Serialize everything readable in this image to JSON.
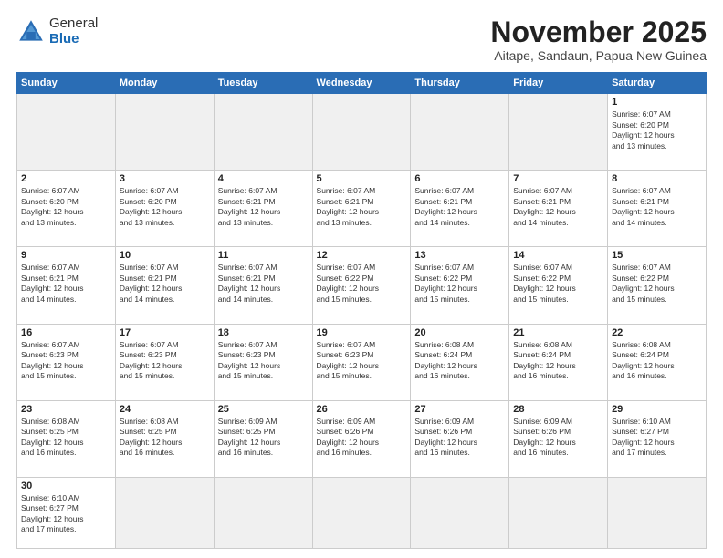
{
  "header": {
    "logo_general": "General",
    "logo_blue": "Blue",
    "month": "November 2025",
    "location": "Aitape, Sandaun, Papua New Guinea"
  },
  "days_of_week": [
    "Sunday",
    "Monday",
    "Tuesday",
    "Wednesday",
    "Thursday",
    "Friday",
    "Saturday"
  ],
  "weeks": [
    [
      {
        "day": "",
        "info": "",
        "empty": true
      },
      {
        "day": "",
        "info": "",
        "empty": true
      },
      {
        "day": "",
        "info": "",
        "empty": true
      },
      {
        "day": "",
        "info": "",
        "empty": true
      },
      {
        "day": "",
        "info": "",
        "empty": true
      },
      {
        "day": "",
        "info": "",
        "empty": true
      },
      {
        "day": "1",
        "info": "Sunrise: 6:07 AM\nSunset: 6:20 PM\nDaylight: 12 hours\nand 13 minutes."
      }
    ],
    [
      {
        "day": "2",
        "info": "Sunrise: 6:07 AM\nSunset: 6:20 PM\nDaylight: 12 hours\nand 13 minutes."
      },
      {
        "day": "3",
        "info": "Sunrise: 6:07 AM\nSunset: 6:20 PM\nDaylight: 12 hours\nand 13 minutes."
      },
      {
        "day": "4",
        "info": "Sunrise: 6:07 AM\nSunset: 6:21 PM\nDaylight: 12 hours\nand 13 minutes."
      },
      {
        "day": "5",
        "info": "Sunrise: 6:07 AM\nSunset: 6:21 PM\nDaylight: 12 hours\nand 13 minutes."
      },
      {
        "day": "6",
        "info": "Sunrise: 6:07 AM\nSunset: 6:21 PM\nDaylight: 12 hours\nand 14 minutes."
      },
      {
        "day": "7",
        "info": "Sunrise: 6:07 AM\nSunset: 6:21 PM\nDaylight: 12 hours\nand 14 minutes."
      },
      {
        "day": "8",
        "info": "Sunrise: 6:07 AM\nSunset: 6:21 PM\nDaylight: 12 hours\nand 14 minutes."
      }
    ],
    [
      {
        "day": "9",
        "info": "Sunrise: 6:07 AM\nSunset: 6:21 PM\nDaylight: 12 hours\nand 14 minutes."
      },
      {
        "day": "10",
        "info": "Sunrise: 6:07 AM\nSunset: 6:21 PM\nDaylight: 12 hours\nand 14 minutes."
      },
      {
        "day": "11",
        "info": "Sunrise: 6:07 AM\nSunset: 6:21 PM\nDaylight: 12 hours\nand 14 minutes."
      },
      {
        "day": "12",
        "info": "Sunrise: 6:07 AM\nSunset: 6:22 PM\nDaylight: 12 hours\nand 15 minutes."
      },
      {
        "day": "13",
        "info": "Sunrise: 6:07 AM\nSunset: 6:22 PM\nDaylight: 12 hours\nand 15 minutes."
      },
      {
        "day": "14",
        "info": "Sunrise: 6:07 AM\nSunset: 6:22 PM\nDaylight: 12 hours\nand 15 minutes."
      },
      {
        "day": "15",
        "info": "Sunrise: 6:07 AM\nSunset: 6:22 PM\nDaylight: 12 hours\nand 15 minutes."
      }
    ],
    [
      {
        "day": "16",
        "info": "Sunrise: 6:07 AM\nSunset: 6:23 PM\nDaylight: 12 hours\nand 15 minutes."
      },
      {
        "day": "17",
        "info": "Sunrise: 6:07 AM\nSunset: 6:23 PM\nDaylight: 12 hours\nand 15 minutes."
      },
      {
        "day": "18",
        "info": "Sunrise: 6:07 AM\nSunset: 6:23 PM\nDaylight: 12 hours\nand 15 minutes."
      },
      {
        "day": "19",
        "info": "Sunrise: 6:07 AM\nSunset: 6:23 PM\nDaylight: 12 hours\nand 15 minutes."
      },
      {
        "day": "20",
        "info": "Sunrise: 6:08 AM\nSunset: 6:24 PM\nDaylight: 12 hours\nand 16 minutes."
      },
      {
        "day": "21",
        "info": "Sunrise: 6:08 AM\nSunset: 6:24 PM\nDaylight: 12 hours\nand 16 minutes."
      },
      {
        "day": "22",
        "info": "Sunrise: 6:08 AM\nSunset: 6:24 PM\nDaylight: 12 hours\nand 16 minutes."
      }
    ],
    [
      {
        "day": "23",
        "info": "Sunrise: 6:08 AM\nSunset: 6:25 PM\nDaylight: 12 hours\nand 16 minutes."
      },
      {
        "day": "24",
        "info": "Sunrise: 6:08 AM\nSunset: 6:25 PM\nDaylight: 12 hours\nand 16 minutes."
      },
      {
        "day": "25",
        "info": "Sunrise: 6:09 AM\nSunset: 6:25 PM\nDaylight: 12 hours\nand 16 minutes."
      },
      {
        "day": "26",
        "info": "Sunrise: 6:09 AM\nSunset: 6:26 PM\nDaylight: 12 hours\nand 16 minutes."
      },
      {
        "day": "27",
        "info": "Sunrise: 6:09 AM\nSunset: 6:26 PM\nDaylight: 12 hours\nand 16 minutes."
      },
      {
        "day": "28",
        "info": "Sunrise: 6:09 AM\nSunset: 6:26 PM\nDaylight: 12 hours\nand 16 minutes."
      },
      {
        "day": "29",
        "info": "Sunrise: 6:10 AM\nSunset: 6:27 PM\nDaylight: 12 hours\nand 17 minutes."
      }
    ],
    [
      {
        "day": "30",
        "info": "Sunrise: 6:10 AM\nSunset: 6:27 PM\nDaylight: 12 hours\nand 17 minutes."
      },
      {
        "day": "",
        "info": "",
        "empty": true
      },
      {
        "day": "",
        "info": "",
        "empty": true
      },
      {
        "day": "",
        "info": "",
        "empty": true
      },
      {
        "day": "",
        "info": "",
        "empty": true
      },
      {
        "day": "",
        "info": "",
        "empty": true
      },
      {
        "day": "",
        "info": "",
        "empty": true
      }
    ]
  ]
}
